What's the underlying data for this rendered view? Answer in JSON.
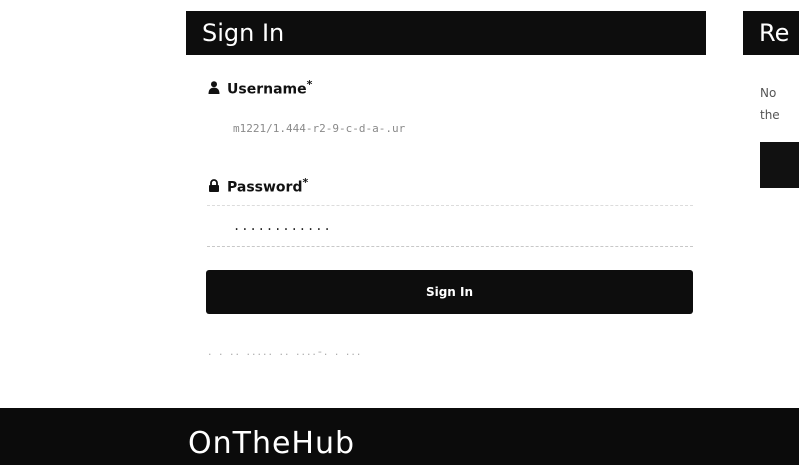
{
  "signin": {
    "title": "Sign In",
    "username_label": "Username",
    "username_required_mark": "*",
    "username_value": "m1221/1.444-r2-9-c-d-a-.ur",
    "password_label": "Password",
    "password_required_mark": "*",
    "password_value": "............",
    "submit_label": "Sign In",
    "forgot_link": ". . .. ..... .. ....-. . ..."
  },
  "register": {
    "title": "Re",
    "text_line1": "No",
    "text_line2": "the"
  },
  "footer": {
    "brand": "OnTheHub"
  },
  "icons": {
    "username": "user-icon",
    "password": "lock-icon"
  },
  "colors": {
    "header_bg": "#0d0d0d",
    "button_bg": "#0d0d0d",
    "footer_bg": "#0b0b0b"
  }
}
